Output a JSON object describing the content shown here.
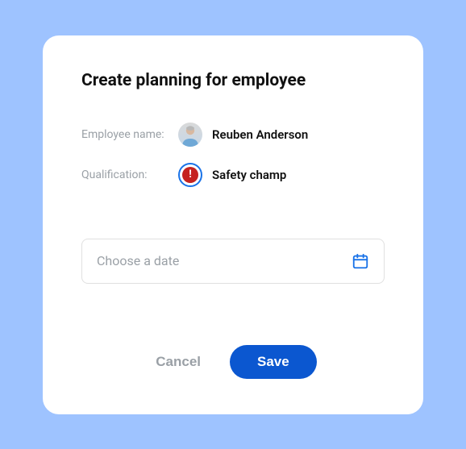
{
  "dialog": {
    "title": "Create planning for employee",
    "employee": {
      "label": "Employee name:",
      "name": "Reuben Anderson"
    },
    "qualification": {
      "label": "Qualification:",
      "name": "Safety champ",
      "icon": "alert-badge"
    },
    "date": {
      "placeholder": "Choose a date",
      "value": ""
    },
    "actions": {
      "cancel": "Cancel",
      "save": "Save"
    }
  },
  "colors": {
    "primary": "#0b57d0",
    "danger": "#c5221f",
    "muted": "#9aa0a6"
  }
}
